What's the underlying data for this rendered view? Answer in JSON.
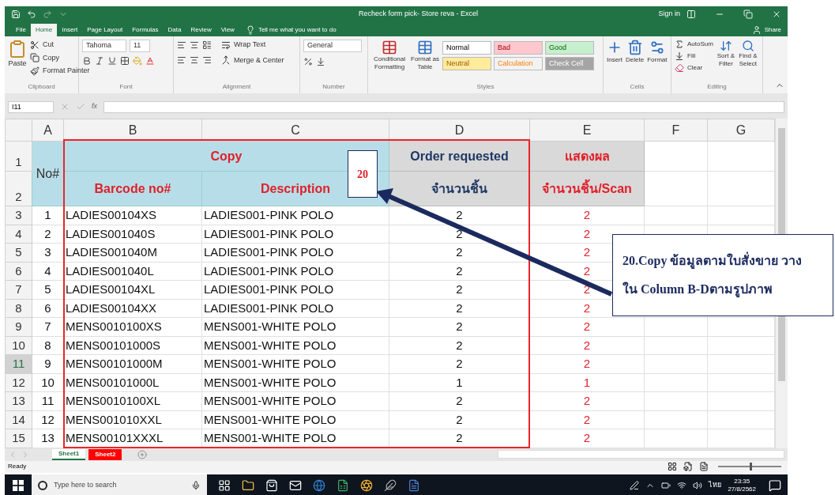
{
  "window": {
    "title": "Recheck form pick- Store reva - Excel",
    "sign_in": "Sign in"
  },
  "ribbon_tabs": [
    {
      "label": "File",
      "selected": false
    },
    {
      "label": "Home",
      "selected": true
    },
    {
      "label": "Insert",
      "selected": false
    },
    {
      "label": "Page Layout",
      "selected": false
    },
    {
      "label": "Formulas",
      "selected": false
    },
    {
      "label": "Data",
      "selected": false
    },
    {
      "label": "Review",
      "selected": false
    },
    {
      "label": "View",
      "selected": false
    }
  ],
  "tell_me": "Tell me what you want to do",
  "share": "Share",
  "ribbon": {
    "clipboard": {
      "paste": "Paste",
      "cut": "Cut",
      "copy": "Copy",
      "format_painter": "Format Painter",
      "label": "Clipboard"
    },
    "font": {
      "name": "Tahoma",
      "size": "11",
      "label": "Font"
    },
    "alignment": {
      "wrap": "Wrap Text",
      "merge": "Merge & Center",
      "label": "Alignment"
    },
    "number": {
      "format": "General",
      "label": "Number"
    },
    "styles": {
      "conditional": "Conditional Formatting",
      "format_table": "Format as Table",
      "label": "Styles",
      "cells": [
        {
          "label": "Normal",
          "kind": "normal"
        },
        {
          "label": "Bad",
          "kind": "bad"
        },
        {
          "label": "Good",
          "kind": "good"
        },
        {
          "label": "Neutral",
          "kind": "neutral"
        },
        {
          "label": "Calculation",
          "kind": "calculation"
        },
        {
          "label": "Check Cell",
          "kind": "check"
        }
      ]
    },
    "cells": {
      "insert": "Insert",
      "delete": "Delete",
      "format": "Format",
      "label": "Cells"
    },
    "editing": {
      "autosum": "AutoSum",
      "fill": "Fill",
      "clear": "Clear",
      "sort": "Sort & Filter",
      "find": "Find & Select",
      "label": "Editing"
    }
  },
  "formula_bar": {
    "name_box": "I11",
    "fx": "fx"
  },
  "sheet": {
    "columns": [
      {
        "label": "A",
        "selected": false
      },
      {
        "label": "B",
        "selected": false
      },
      {
        "label": "C",
        "selected": false
      },
      {
        "label": "D",
        "selected": false
      },
      {
        "label": "E",
        "selected": false
      },
      {
        "label": "F",
        "selected": false
      },
      {
        "label": "G",
        "selected": false
      }
    ],
    "header": {
      "row_1": {
        "row": "1",
        "selected": false
      },
      "row_2": {
        "row": "2",
        "selected": false
      },
      "no": "No#",
      "copy": "Copy",
      "order": "Order requested",
      "result": "แสดงผล",
      "barcode": "Barcode no#",
      "description": "Description",
      "qty": "จำนวนชิ้น",
      "scan": "จำนวนชิ้น/Scan"
    },
    "rows": [
      {
        "row": "3",
        "selected": false,
        "cells": [
          "1",
          "LADIES00104XS",
          "LADIES001-PINK POLO",
          "2",
          "2"
        ]
      },
      {
        "row": "4",
        "selected": false,
        "cells": [
          "2",
          "LADIES001040S",
          "LADIES001-PINK POLO",
          "2",
          "2"
        ]
      },
      {
        "row": "5",
        "selected": false,
        "cells": [
          "3",
          "LADIES001040M",
          "LADIES001-PINK POLO",
          "2",
          "2"
        ]
      },
      {
        "row": "6",
        "selected": false,
        "cells": [
          "4",
          "LADIES001040L",
          "LADIES001-PINK POLO",
          "2",
          "2"
        ]
      },
      {
        "row": "7",
        "selected": false,
        "cells": [
          "5",
          "LADIES00104XL",
          "LADIES001-PINK POLO",
          "2",
          "2"
        ]
      },
      {
        "row": "8",
        "selected": false,
        "cells": [
          "6",
          "LADIES00104XX",
          "LADIES001-PINK POLO",
          "2",
          "2"
        ]
      },
      {
        "row": "9",
        "selected": false,
        "cells": [
          "7",
          "MENS0010100XS",
          "MENS001-WHITE POLO",
          "2",
          "2"
        ]
      },
      {
        "row": "10",
        "selected": false,
        "cells": [
          "8",
          "MENS00101000S",
          "MENS001-WHITE POLO",
          "2",
          "2"
        ]
      },
      {
        "row": "11",
        "selected": true,
        "cells": [
          "9",
          "MENS00101000M",
          "MENS001-WHITE POLO",
          "2",
          "2"
        ]
      },
      {
        "row": "12",
        "selected": false,
        "cells": [
          "10",
          "MENS00101000L",
          "MENS001-WHITE POLO",
          "1",
          "1"
        ]
      },
      {
        "row": "13",
        "selected": false,
        "cells": [
          "11",
          "MENS0010100XL",
          "MENS001-WHITE POLO",
          "2",
          "2"
        ]
      },
      {
        "row": "14",
        "selected": false,
        "cells": [
          "12",
          "MENS001010XXL",
          "MENS001-WHITE POLO",
          "2",
          "2"
        ]
      },
      {
        "row": "15",
        "selected": false,
        "cells": [
          "13",
          "MENS00101XXXL",
          "MENS001-WHITE POLO",
          "2",
          "2"
        ]
      }
    ]
  },
  "annotations": {
    "step_number": "20",
    "note_lines": [
      "20.Copy ข้อมูลตามใบสั่งขาย วาง",
      "ใน Column B-Dตามรูปภาพ"
    ]
  },
  "sheet_tabs": [
    {
      "label": "Sheet1",
      "selected": true
    },
    {
      "label": "Sheet2",
      "selected": false,
      "color": "#ff0000"
    }
  ],
  "status_bar": {
    "status": "Ready",
    "zoom": {
      "level": 0.5
    }
  },
  "taskbar": {
    "search": {
      "placeholder": "Type here to search"
    },
    "language": "ไทย",
    "time": "23:35",
    "date": "27/8/2562"
  }
}
